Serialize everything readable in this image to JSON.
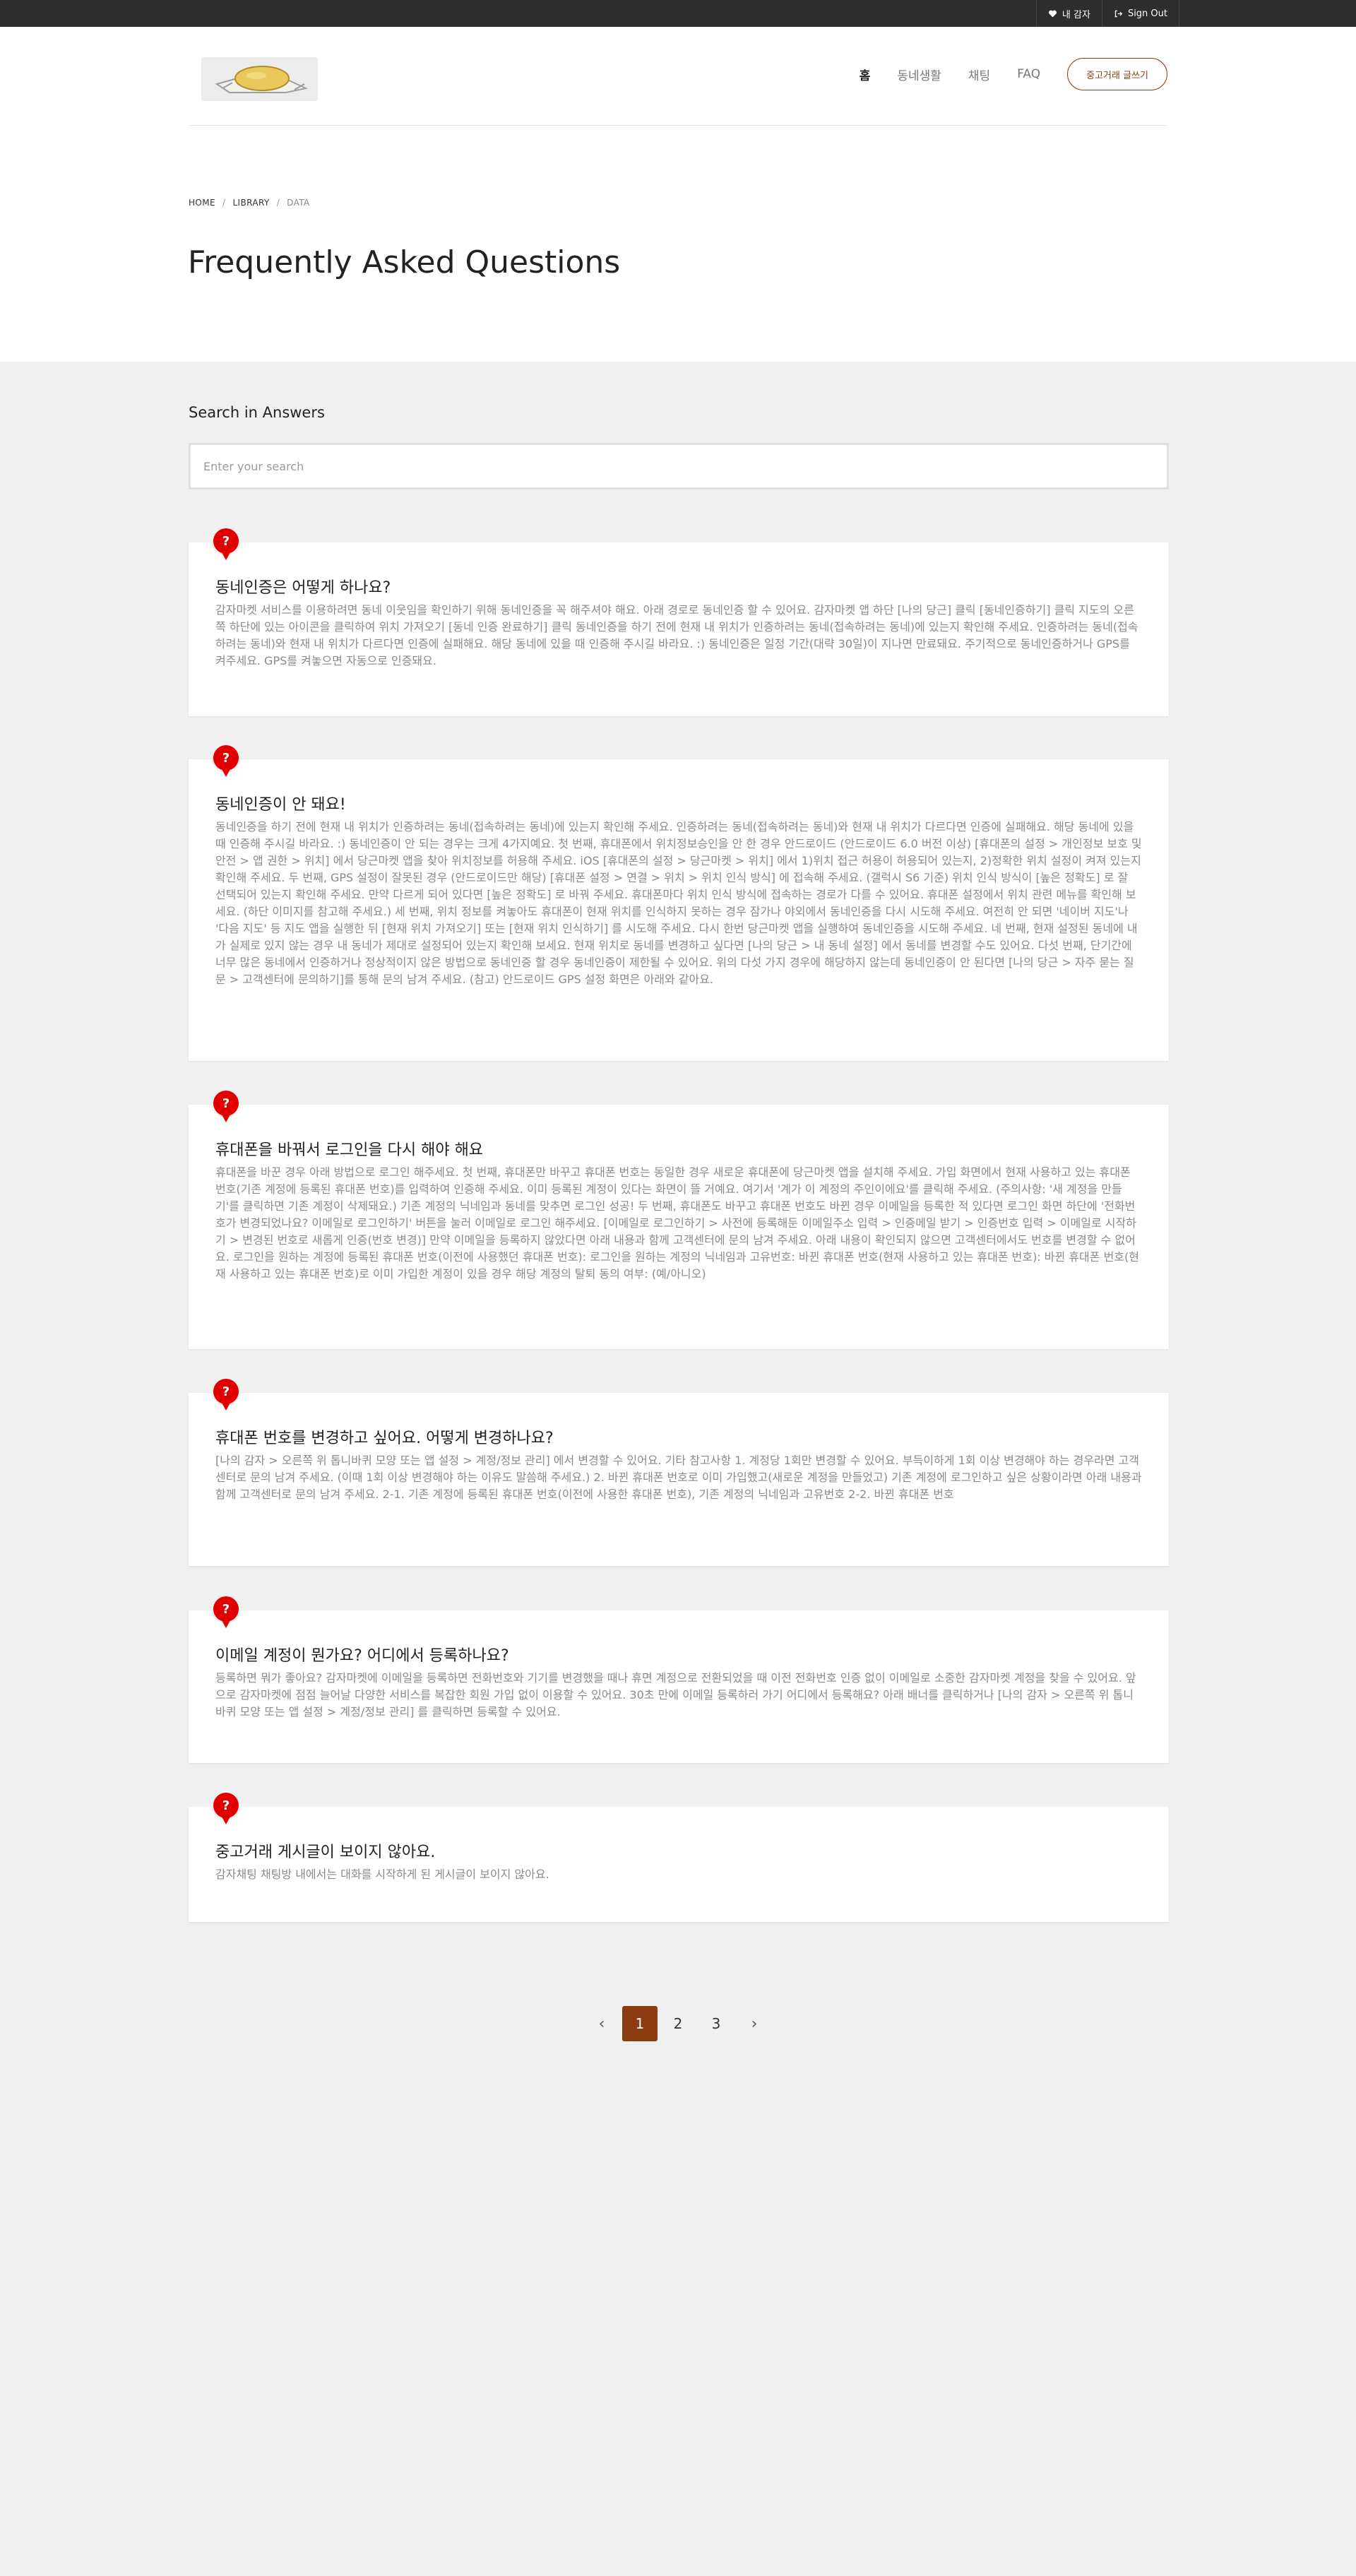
{
  "topbar": {
    "account_label": "내 감자",
    "signout_label": "Sign Out"
  },
  "nav": {
    "items": [
      {
        "label": "홈"
      },
      {
        "label": "동네생활"
      },
      {
        "label": "채팅"
      },
      {
        "label": "FAQ"
      }
    ],
    "active_index": 0,
    "cta_label": "중고거래 글쓰기"
  },
  "breadcrumb": {
    "home": "HOME",
    "library": "LIBRARY",
    "current": "DATA"
  },
  "page_title": "Frequently Asked Questions",
  "search": {
    "label": "Search in Answers",
    "placeholder": "Enter your search",
    "value": ""
  },
  "faqs": [
    {
      "badge": "?",
      "question": "동네인증은 어떻게 하나요?",
      "answer": "감자마켓 서비스를 이용하려면 동네 이웃임을 확인하기 위해 동네인증을 꼭 해주셔야 해요. 아래 경로로 동네인증 할 수 있어요. 감자마켓 앱 하단 [나의 당근] 클릭 [동네인증하기] 클릭 지도의 오른쪽 하단에 있는 아이콘을 클릭하여 위치 가져오기 [동네 인증 완료하기] 클릭 동네인증을 하기 전에 현재 내 위치가 인증하려는 동네(접속하려는 동네)에 있는지 확인해 주세요. 인증하려는 동네(접속하려는 동네)와 현재 내 위치가 다르다면 인증에 실패해요. 해당 동네에 있을 때 인증해 주시길 바라요. :) 동네인증은 일정 기간(대략 30일)이 지나면 만료돼요. 주기적으로 동네인증하거나 GPS를 켜주세요. GPS를 켜놓으면 자동으로 인증돼요."
    },
    {
      "badge": "?",
      "question": "동네인증이 안 돼요!",
      "answer": "동네인증을 하기 전에 현재 내 위치가 인증하려는 동네(접속하려는 동네)에 있는지 확인해 주세요. 인증하려는 동네(접속하려는 동네)와 현재 내 위치가 다르다면 인증에 실패해요. 해당 동네에 있을 때 인증해 주시길 바라요. :) 동네인증이 안 되는 경우는 크게 4가지예요. 첫 번째, 휴대폰에서 위치정보승인을 안 한 경우 안드로이드 (안드로이드 6.0 버전 이상) [휴대폰의 설정 > 개인정보 보호 및 안전 > 앱 권한 > 위치] 에서 당근마켓 앱을 찾아 위치정보를 허용해 주세요. iOS [휴대폰의 설정 > 당근마켓 > 위치] 에서 1)위치 접근 허용이 허용되어 있는지, 2)정확한 위치 설정이 켜져 있는지 확인해 주세요. 두 번째, GPS 설정이 잘못된 경우 (안드로이드만 해당) [휴대폰 설정 > 연결 > 위치 > 위치 인식 방식] 에 접속해 주세요. (갤럭시 S6 기준) 위치 인식 방식이 [높은 정확도] 로 잘 선택되어 있는지 확인해 주세요. 만약 다르게 되어 있다면 [높은 정확도] 로 바꿔 주세요. 휴대폰마다 위치 인식 방식에 접속하는 경로가 다를 수 있어요. 휴대폰 설정에서 위치 관련 메뉴를 확인해 보세요. (하단 이미지를 참고해 주세요.) 세 번째, 위치 정보를 켜놓아도 휴대폰이 현재 위치를 인식하지 못하는 경우 잠가나 야외에서 동네인증을 다시 시도해 주세요. 여전히 안 되면 '네이버 지도'나 '다음 지도' 등 지도 앱을 실행한 뒤 [현재 위치 가져오기] 또는 [현재 위치 인식하기] 를 시도해 주세요. 다시 한번 당근마켓 앱을 실행하여 동네인증을 시도해 주세요. 네 번째, 현재 설정된 동네에 내가 실제로 있지 않는 경우 내 동네가 제대로 설정되어 있는지 확인해 보세요. 현재 위치로 동네를 변경하고 싶다면 [나의 당근 > 내 동네 설정] 에서 동네를 변경할 수도 있어요. 다섯 번째, 단기간에 너무 많은 동네에서 인증하거나 정상적이지 않은 방법으로 동네인증 할 경우 동네인증이 제한될 수 있어요. 위의 다섯 가지 경우에 해당하지 않는데 동네인증이 안 된다면 [나의 당근 > 자주 묻는 질문 > 고객센터에 문의하기]를 통해 문의 남겨 주세요. (참고) 안드로이드 GPS 설정 화면은 아래와 같아요."
    },
    {
      "badge": "?",
      "question": "휴대폰을 바꿔서 로그인을 다시 해야 해요",
      "answer": "휴대폰을 바꾼 경우 아래 방법으로 로그인 해주세요. 첫 번째, 휴대폰만 바꾸고 휴대폰 번호는 동일한 경우 새로운 휴대폰에 당근마켓 앱을 설치해 주세요. 가입 화면에서 현재 사용하고 있는 휴대폰 번호(기존 계정에 등록된 휴대폰 번호)를 입력하여 인증해 주세요. 이미 등록된 계정이 있다는 화면이 뜰 거예요. 여기서 '계가 이 계정의 주인이에요'를 클릭해 주세요. (주의사항: '새 계정을 만들기'를 클릭하면 기존 계정이 삭제돼요.) 기존 계정의 닉네임과 동네를 맞추면 로그인 성공! 두 번째, 휴대폰도 바꾸고 휴대폰 번호도 바뀐 경우 이메일을 등록한 적 있다면 로그인 화면 하단에 '전화번호가 변경되었나요? 이메일로 로그인하기' 버튼을 눌러 이메일로 로그인 해주세요. [이메일로 로그인하기 > 사전에 등록해둔 이메일주소 입력 > 인증메일 받기 > 인증번호 입력 > 이메일로 시작하기 > 변경된 번호로 새롭게 인증(번호 변경)] 만약 이메일을 등록하지 않았다면 아래 내용과 함께 고객센터에 문의 남겨 주세요. 아래 내용이 확인되지 않으면 고객센터에서도 번호를 변경할 수 없어요. 로그인을 원하는 계정에 등록된 휴대폰 번호(이전에 사용했던 휴대폰 번호): 로그인을 원하는 계정의 닉네임과 고유번호: 바뀐 휴대폰 번호(현재 사용하고 있는 휴대폰 번호): 바뀐 휴대폰 번호(현재 사용하고 있는 휴대폰 번호)로 이미 가입한 계정이 있을 경우 해당 계정의 탈퇴 동의 여부: (예/아니오)"
    },
    {
      "badge": "?",
      "question": "휴대폰 번호를 변경하고 싶어요. 어떻게 변경하나요?",
      "answer": "[나의 감자 > 오른쪽 위 톱니바퀴 모양 또는 앱 설정 > 계정/정보 관리] 에서 변경할 수 있어요. 기타 참고사항 1. 계정당 1회만 변경할 수 있어요. 부득이하게 1회 이상 변경해야 하는 경우라면 고객센터로 문의 남겨 주세요. (이때 1회 이상 변경해야 하는 이유도 말씀해 주세요.) 2. 바뀐 휴대폰 번호로 이미 가입했고(새로운 계정을 만들었고) 기존 계정에 로그인하고 싶은 상황이라면 아래 내용과 함께 고객센터로 문의 남겨 주세요. 2-1. 기존 계정에 등록된 휴대폰 번호(이전에 사용한 휴대폰 번호), 기존 계정의 닉네임과 고유번호 2-2. 바뀐 휴대폰 번호"
    },
    {
      "badge": "?",
      "question": "이메일 계정이 뭔가요? 어디에서 등록하나요?",
      "answer": "등록하면 뭐가 좋아요? 감자마켓에 이메일을 등록하면 전화번호와 기기를 변경했을 때나 휴면 계정으로 전환되었을 때 이전 전화번호 인증 없이 이메일로 소중한 감자마켓 계정을 찾을 수 있어요. 앞으로 감자마켓에 점점 늘어날 다양한 서비스를 복잡한 회원 가입 없이 이용할 수 있어요. 30초 만에 이메일 등록하러 가기 어디에서 등록해요? 아래 배너를 클릭하거나 [나의 감자 > 오른쪽 위 톱니바퀴 모양 또는 앱 설정 > 계정/정보 관리] 를 클릭하면 등록할 수 있어요."
    },
    {
      "badge": "?",
      "question": "중고거래 게시글이 보이지 않아요.",
      "answer": "감자채팅 채팅방 내에서는 대화를 시작하게 된 게시글이 보이지 않아요."
    }
  ],
  "pagination": {
    "prev": "‹",
    "pages": [
      "1",
      "2",
      "3"
    ],
    "current": "1",
    "next": "›"
  },
  "colors": {
    "accent": "#8b3d11",
    "badge": "#e00000",
    "topbar": "#2d2d2d"
  }
}
